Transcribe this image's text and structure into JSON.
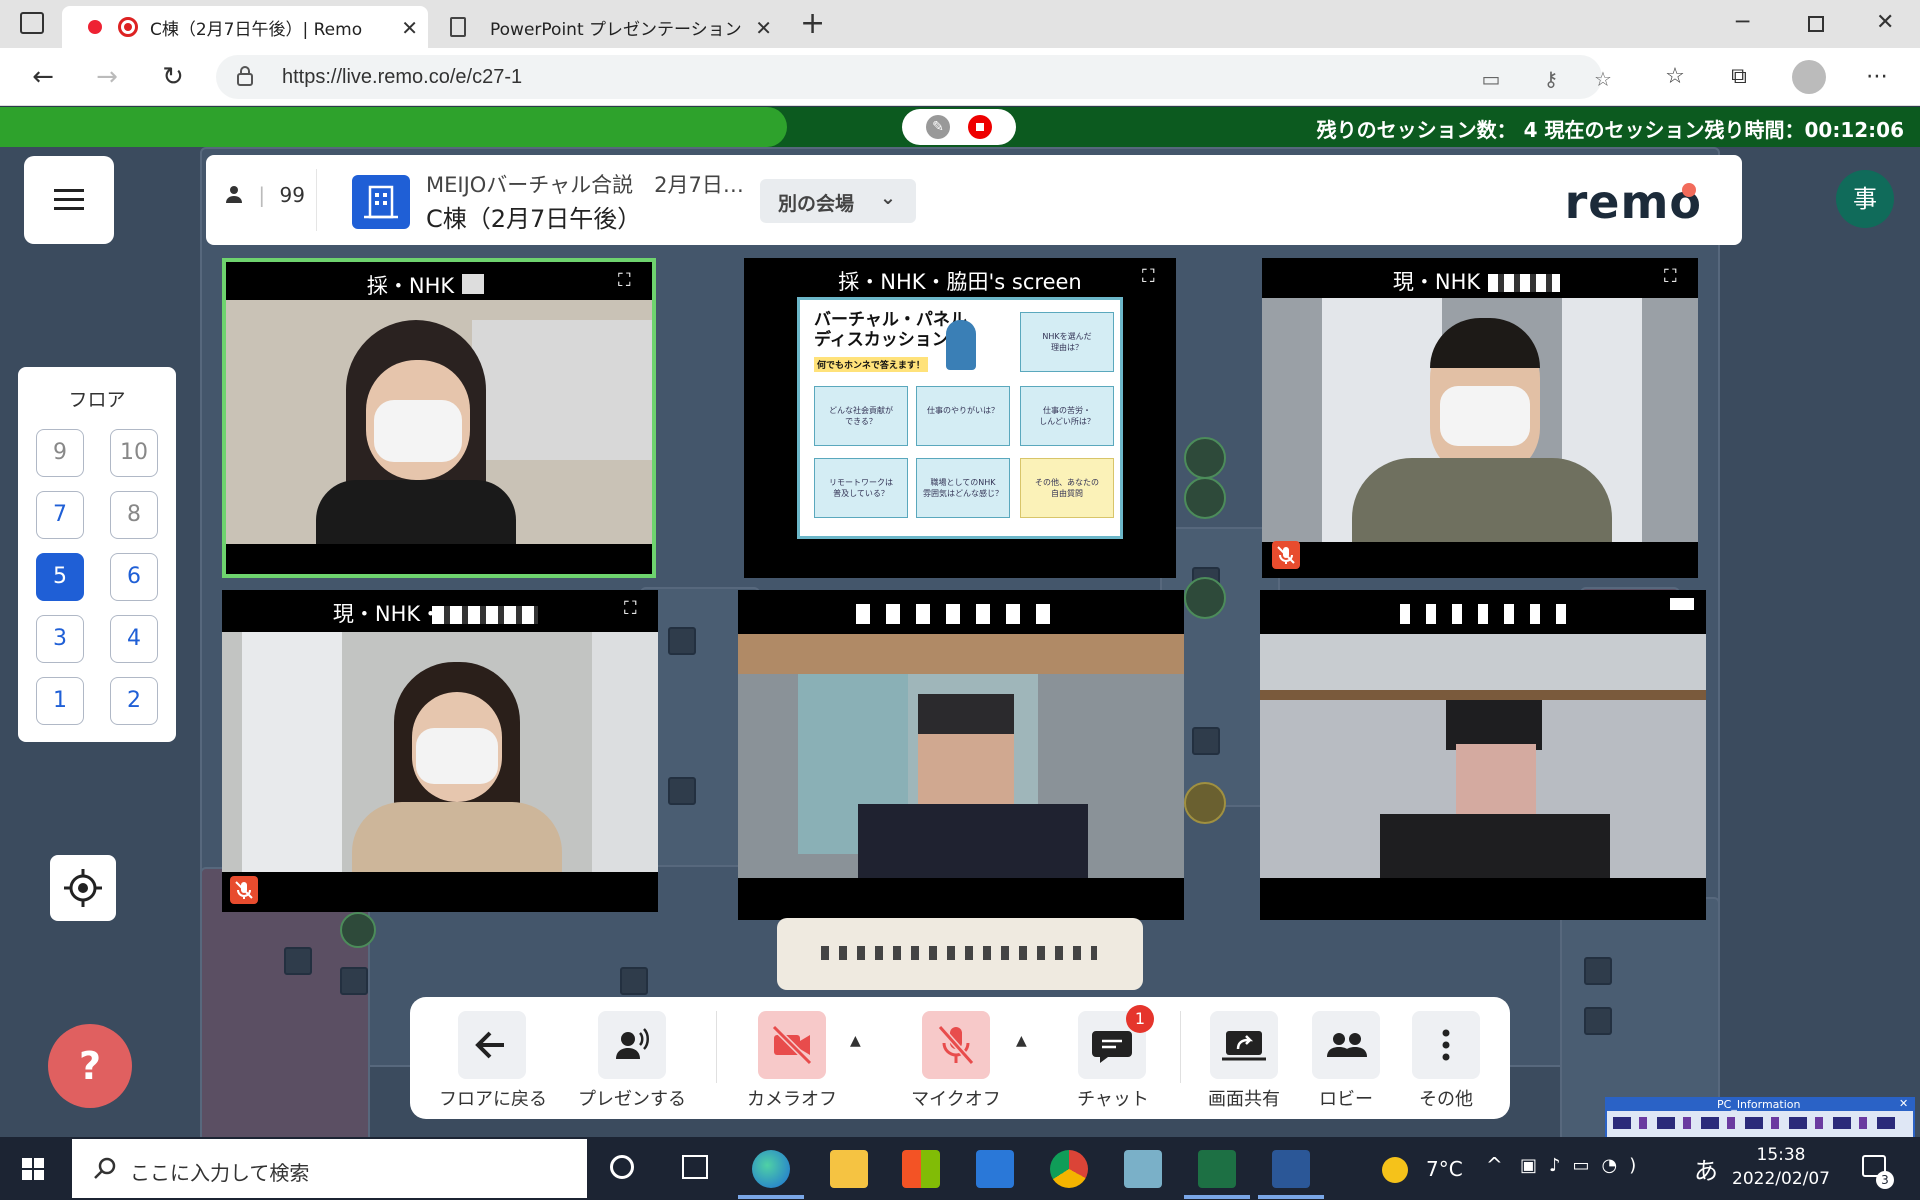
{
  "browser": {
    "tabs": [
      {
        "title": "C棟（2月7日午後）| Remo",
        "active": true
      },
      {
        "title": "PowerPoint プレゼンテーション",
        "active": false
      }
    ],
    "url": "https://live.remo.co/e/c27-1"
  },
  "session": {
    "status_text": "残りのセッション数： 4 現在のセッション残り時間：00:12:06",
    "progress_percent": 41
  },
  "header": {
    "attendee_count": "99",
    "event_name": "MEIJOバーチャル合説　2月7日…",
    "room_name": "C棟（2月7日午後）",
    "venue_button": "別の会場",
    "logo": "remo",
    "user_initial": "事"
  },
  "floor": {
    "title": "フロア",
    "buttons": [
      {
        "label": "9",
        "state": "dim"
      },
      {
        "label": "10",
        "state": "dim"
      },
      {
        "label": "7",
        "state": "normal"
      },
      {
        "label": "8",
        "state": "dim"
      },
      {
        "label": "5",
        "state": "selected"
      },
      {
        "label": "6",
        "state": "normal"
      },
      {
        "label": "3",
        "state": "normal"
      },
      {
        "label": "4",
        "state": "normal"
      },
      {
        "label": "1",
        "state": "normal"
      },
      {
        "label": "2",
        "state": "normal"
      }
    ]
  },
  "tiles": [
    {
      "name": "採・NHK・"
    },
    {
      "name": "採・NHK・脇田's screen"
    },
    {
      "name": "現・NHK・"
    },
    {
      "name": "現・NHK・"
    },
    {
      "name": ""
    },
    {
      "name": ""
    }
  ],
  "slide": {
    "title": "バーチャル・パネル\nディスカッション",
    "subtitle": "何でもホンネで答えます！",
    "boxes": [
      "NHKを選んだ\n理由は？",
      "どんな社会貢献が\nできる？",
      "仕事のやりがいは？",
      "仕事の苦労・\nしんどい所は？",
      "リモートワークは\n普及している？",
      "職場としてのNHK\n雰囲気はどんな感じ？",
      "その他、あなたの\n自由質問"
    ]
  },
  "toolbar": {
    "back_label": "フロアに戻る",
    "present_label": "プレゼンする",
    "camera_label": "カメラオフ",
    "mic_label": "マイクオフ",
    "chat_label": "チャット",
    "chat_badge": "1",
    "share_label": "画面共有",
    "lobby_label": "ロビー",
    "more_label": "その他"
  },
  "taskbar": {
    "search_placeholder": "ここに入力して検索",
    "weather": "7°C",
    "ime": "あ",
    "time": "15:38",
    "date": "2022/02/07",
    "notification_count": "3"
  },
  "pc_info": {
    "title": "PC_Information"
  },
  "colors": {
    "accent_blue": "#1f5fd6",
    "session_green": "#2ea22c",
    "session_dark": "#0c5a1f",
    "active_speaker": "#6ed36e",
    "mute_red": "#e84c2e"
  }
}
